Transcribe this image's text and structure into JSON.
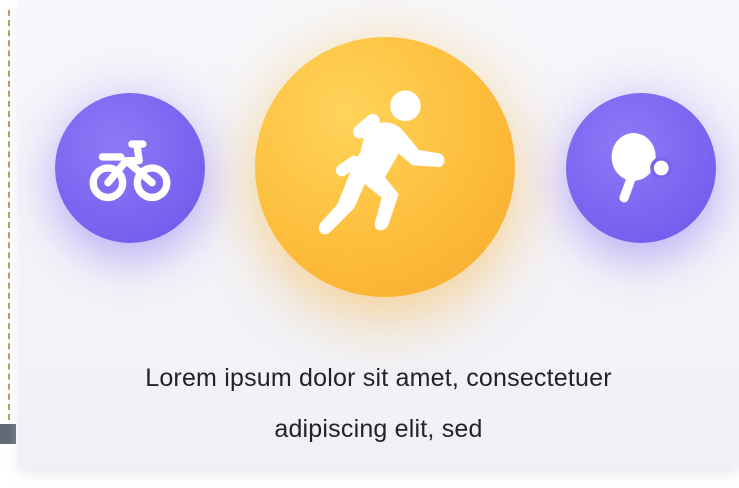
{
  "caption": {
    "line1": "Lorem ipsum dolor sit amet, consectetuer",
    "line2": "adipiscing elit, sed"
  },
  "icons": {
    "left": "bicycle-icon",
    "center": "running-person-icon",
    "right": "ping-pong-paddle-icon"
  },
  "colors": {
    "purple": "#7a64f0",
    "gold": "#fdbd3b",
    "background": "#f3f3f8",
    "text": "#222228"
  }
}
